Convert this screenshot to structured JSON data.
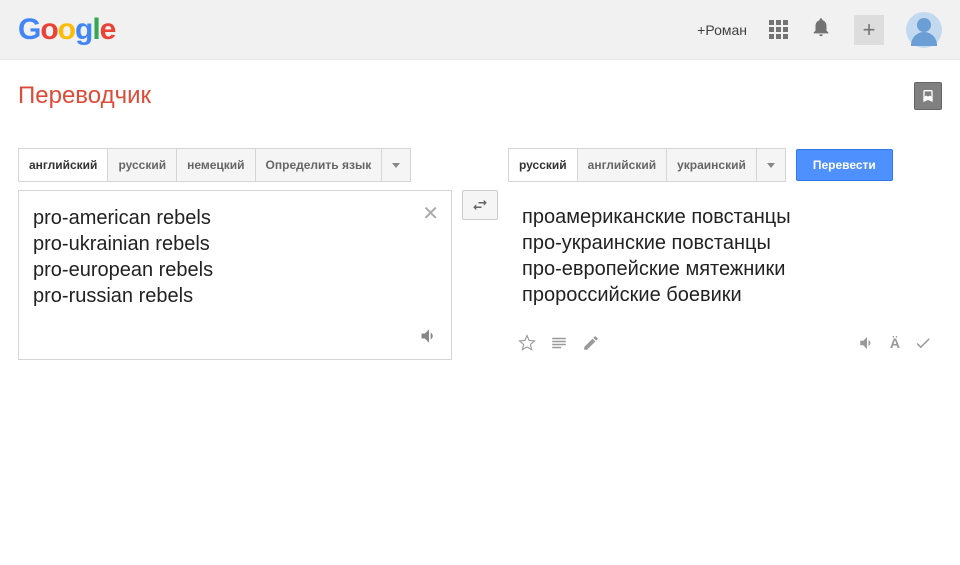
{
  "header": {
    "logo_letters": [
      "G",
      "o",
      "o",
      "g",
      "l",
      "e"
    ],
    "plus_name": "+Роман"
  },
  "page": {
    "title": "Переводчик"
  },
  "source": {
    "tabs": [
      "английский",
      "русский",
      "немецкий",
      "Определить язык"
    ],
    "active_index": 0,
    "text": "pro-american rebels\npro-ukrainian rebels\npro-european rebels\npro-russian rebels"
  },
  "target": {
    "tabs": [
      "русский",
      "английский",
      "украинский"
    ],
    "active_index": 0,
    "translate_label": "Перевести",
    "text": "проамериканские повстанцы\nпро-украинские повстанцы\nпро-европейские мятежники\nпророссийские боевики"
  }
}
